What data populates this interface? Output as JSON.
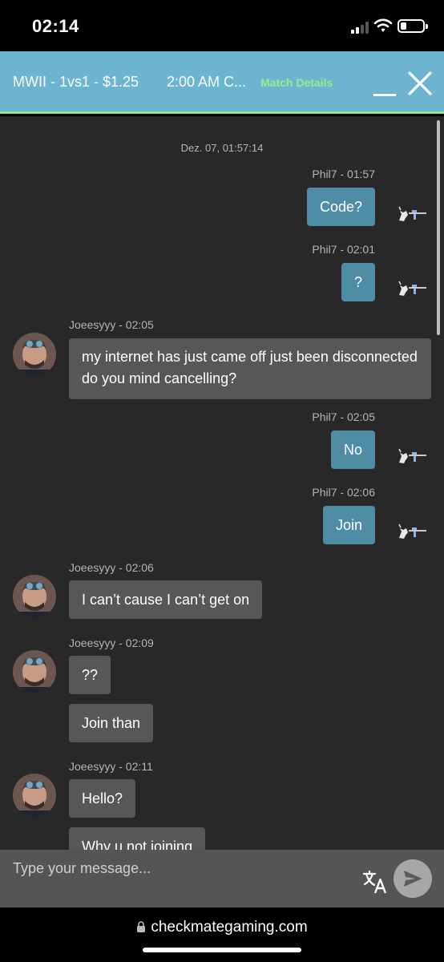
{
  "status_bar": {
    "time": "02:14"
  },
  "header": {
    "title": "MWII - 1vs1 - $1.25",
    "time": "2:00 AM C...",
    "match_details": "Match Details"
  },
  "chat": {
    "date_stamp": "Dez. 07, 01:57:14",
    "messages": [
      {
        "meta": "Phil7  - 01:57",
        "text": "Code?"
      },
      {
        "meta": "Phil7  - 02:01",
        "text": "?"
      },
      {
        "meta": "Joeesyyy - 02:05",
        "text": "my internet has just came off just been disconnected do you mind cancelling?"
      },
      {
        "meta": "Phil7  - 02:05",
        "text": "No"
      },
      {
        "meta": "Phil7  - 02:06",
        "text": "Join"
      },
      {
        "meta": "Joeesyyy - 02:06",
        "text": "I can’t cause I can’t get on"
      },
      {
        "meta": "Joeesyyy - 02:09",
        "text": "??",
        "text2": "Join than"
      },
      {
        "meta": "Joeesyyy - 02:11",
        "text": "Hello?",
        "text2": "Why u not joining"
      }
    ]
  },
  "input": {
    "placeholder": "Type your message..."
  },
  "browser": {
    "url": "checkmategaming.com"
  },
  "icons": {
    "minimize": "minimize-icon",
    "close": "close-icon",
    "translate": "translate-icon",
    "send": "send-icon",
    "lock": "lock-icon",
    "sender_avatar": "unicorn-sniper-icon",
    "user_avatar": "user-avatar"
  },
  "colors": {
    "header_bg": "#6cb4cf",
    "header_accent": "#8fe38b",
    "chat_bg": "#282828",
    "outgoing_bubble": "#4f8ca6",
    "incoming_bubble": "#575757",
    "input_bg": "#555555"
  }
}
